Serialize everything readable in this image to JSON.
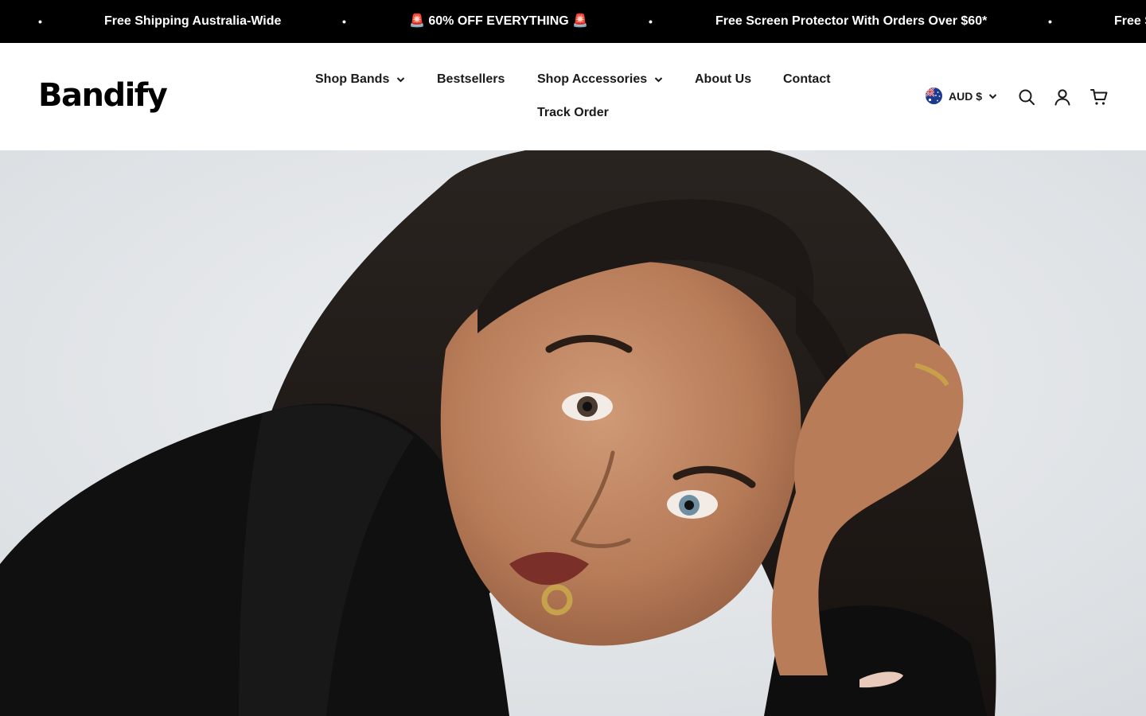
{
  "announcement": {
    "messages": [
      "Free Shipping Australia-Wide",
      "🚨 60% OFF EVERYTHING 🚨",
      "Free Screen Protector With Orders Over $60*",
      "Free S"
    ],
    "separator": "•"
  },
  "header": {
    "logo_text": "Bandify",
    "nav": {
      "shop_bands": "Shop Bands",
      "bestsellers": "Bestsellers",
      "shop_accessories": "Shop Accessories",
      "about_us": "About Us",
      "contact": "Contact",
      "track_order": "Track Order"
    },
    "currency": "AUD $",
    "icons": {
      "search": "search-icon",
      "account": "account-icon",
      "cart": "cart-icon",
      "flag": "australia-flag-icon",
      "dropdown": "chevron-down-icon"
    }
  },
  "hero": {
    "image": "hero-model-photo"
  },
  "colors": {
    "announcement_bg": "#000000",
    "announcement_text": "#ffffff",
    "header_bg": "#ffffff",
    "nav_text": "#1a1a1a",
    "hero_bg": "#e5e8eb"
  }
}
